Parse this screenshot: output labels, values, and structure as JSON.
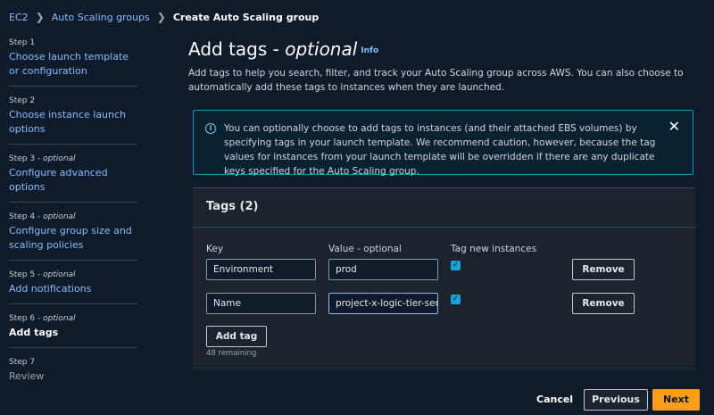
{
  "breadcrumb": {
    "items": [
      "EC2",
      "Auto Scaling groups"
    ],
    "current": "Create Auto Scaling group",
    "separator": ">"
  },
  "sidebar": {
    "steps": [
      {
        "label": "Step 1",
        "optional": "",
        "title": "Choose launch template or configuration"
      },
      {
        "label": "Step 2",
        "optional": "",
        "title": "Choose instance launch options"
      },
      {
        "label": "Step 3 - ",
        "optional": "optional",
        "title": "Configure advanced options"
      },
      {
        "label": "Step 4 - ",
        "optional": "optional",
        "title": "Configure group size and scaling policies"
      },
      {
        "label": "Step 5 - ",
        "optional": "optional",
        "title": "Add notifications"
      },
      {
        "label": "Step 6 - ",
        "optional": "optional",
        "title": "Add tags"
      },
      {
        "label": "Step 7",
        "optional": "",
        "title": "Review"
      }
    ]
  },
  "main": {
    "title": "Add tags - ",
    "title_italic": "optional",
    "info": "Info",
    "description": "Add tags to help you search, filter, and track your Auto Scaling group across AWS. You can also choose to automatically add these tags to instances when they are launched.",
    "alert": {
      "icon": "i",
      "text": "You can optionally choose to add tags to instances (and their attached EBS volumes) by specifying tags in your launch template. We recommend caution, however, because the tag values for instances from your launch template will be overridden if there are any duplicate keys specified for the Auto Scaling group.",
      "close": "✕"
    },
    "tags_panel": {
      "header": "Tags (2)",
      "col_key": "Key",
      "col_value": "Value - optional",
      "col_tag_new": "Tag new instances",
      "rows": [
        {
          "key": "Environment",
          "value": "prod",
          "checked": "✓",
          "remove": "Remove"
        },
        {
          "key": "Name",
          "value": "project-x-logic-tier-serve",
          "checked": "✓",
          "remove": "Remove"
        }
      ],
      "add_tag": "Add tag",
      "remaining": "48 remaining"
    }
  },
  "footer": {
    "cancel": "Cancel",
    "previous": "Previous",
    "next": "Next"
  },
  "colors": {
    "background": "#0f1b2a",
    "link": "#89bdff",
    "primary": "#f89e1b",
    "info_border": "#0a9fb5",
    "checkbox": "#1aa2d9"
  }
}
